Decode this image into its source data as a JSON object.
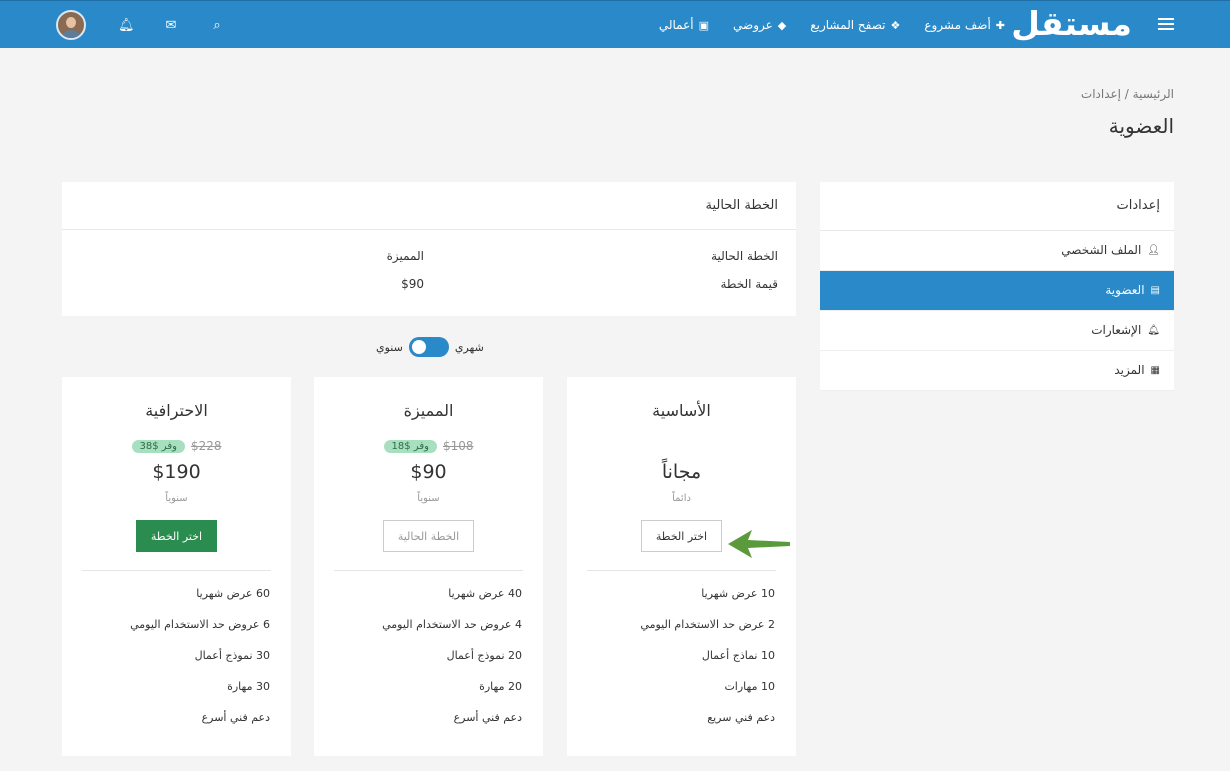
{
  "header": {
    "logo": "مستقل",
    "nav": [
      {
        "label": "أضف مشروع",
        "icon": "plus-icon"
      },
      {
        "label": "تصفح المشاريع",
        "icon": "cubes-icon"
      },
      {
        "label": "عروضي",
        "icon": "tag-icon"
      },
      {
        "label": "أعمالي",
        "icon": "briefcase-icon"
      }
    ]
  },
  "breadcrumb": "الرئيسية / إعدادات",
  "page_title": "العضوية",
  "sidebar": {
    "title": "إعدادات",
    "items": [
      {
        "label": "الملف الشخصي",
        "icon": "user-icon"
      },
      {
        "label": "العضوية",
        "icon": "id-card-icon",
        "active": true
      },
      {
        "label": "الإشعارات",
        "icon": "bell-icon"
      },
      {
        "label": "المزيد",
        "icon": "grid-icon"
      }
    ]
  },
  "current_plan": {
    "title": "الخطة الحالية",
    "rows": [
      {
        "label": "الخطة الحالية",
        "value": "المميزة"
      },
      {
        "label": "قيمة الخطة",
        "value": "$90"
      }
    ]
  },
  "billing_toggle": {
    "monthly": "شهري",
    "yearly": "سنوي"
  },
  "plans": [
    {
      "name": "الأساسية",
      "old_price": "",
      "save": "",
      "price": "مجاناً",
      "period": "دائماً",
      "button": "اختر الخطة",
      "features": [
        "10 عرض شهريا",
        "2 عرض حد الاستخدام اليومي",
        "10 نماذج أعمال",
        "10 مهارات",
        "دعم فني سريع"
      ]
    },
    {
      "name": "المميزة",
      "old_price": "$108",
      "save": "وفر $18",
      "price": "$90",
      "period": "سنوياً",
      "button": "الخطة الحالية",
      "features": [
        "40 عرض شهريا",
        "4 عروض حد الاستخدام اليومي",
        "20 نموذج أعمال",
        "20 مهارة",
        "دعم فني أسرع"
      ]
    },
    {
      "name": "الاحترافية",
      "old_price": "$228",
      "save": "وفر $38",
      "price": "$190",
      "period": "سنوياً",
      "button": "اختر الخطة",
      "features": [
        "60 عرض شهريا",
        "6 عروض حد الاستخدام اليومي",
        "30 نموذج أعمال",
        "30 مهارة",
        "دعم فني أسرع"
      ]
    }
  ],
  "colors": {
    "primary": "#2a89c8",
    "success": "#2b8c4f",
    "arrow": "#5a9a3c"
  }
}
